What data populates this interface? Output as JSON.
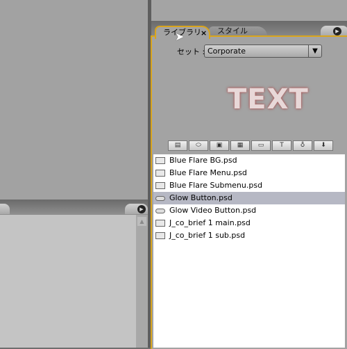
{
  "tabs": [
    {
      "label": "ライブラリ",
      "active": true,
      "close": "×"
    },
    {
      "label": "スタイル",
      "active": false
    }
  ],
  "panel_menu_icon": "play-circle-icon",
  "set": {
    "label": "セット :",
    "value": "Corporate",
    "arrow": "▼"
  },
  "preview_text": "TEXT",
  "filters": [
    {
      "name": "image-filter",
      "glyph": "▤"
    },
    {
      "name": "button-filter",
      "glyph": "⬭"
    },
    {
      "name": "photo-filter",
      "glyph": "▣"
    },
    {
      "name": "pattern-filter",
      "glyph": "▦"
    },
    {
      "name": "folder-filter",
      "glyph": "▭"
    },
    {
      "name": "text-filter",
      "glyph": "T"
    },
    {
      "name": "drop-filter",
      "glyph": "♁"
    },
    {
      "name": "import-filter",
      "glyph": "⬇"
    }
  ],
  "items": [
    {
      "label": "Blue Flare BG.psd",
      "icon": "image",
      "selected": false
    },
    {
      "label": "Blue Flare Menu.psd",
      "icon": "image",
      "selected": false
    },
    {
      "label": "Blue Flare Submenu.psd",
      "icon": "image",
      "selected": false
    },
    {
      "label": "Glow Button.psd",
      "icon": "button",
      "selected": true
    },
    {
      "label": "Glow Video Button.psd",
      "icon": "button",
      "selected": false
    },
    {
      "label": "J_co_brief 1 main.psd",
      "icon": "image",
      "selected": false
    },
    {
      "label": "J_co_brief 1 sub.psd",
      "icon": "image",
      "selected": false
    }
  ],
  "colors": {
    "panel_border": "#d9a51c",
    "selection": "#b6b8c4"
  }
}
